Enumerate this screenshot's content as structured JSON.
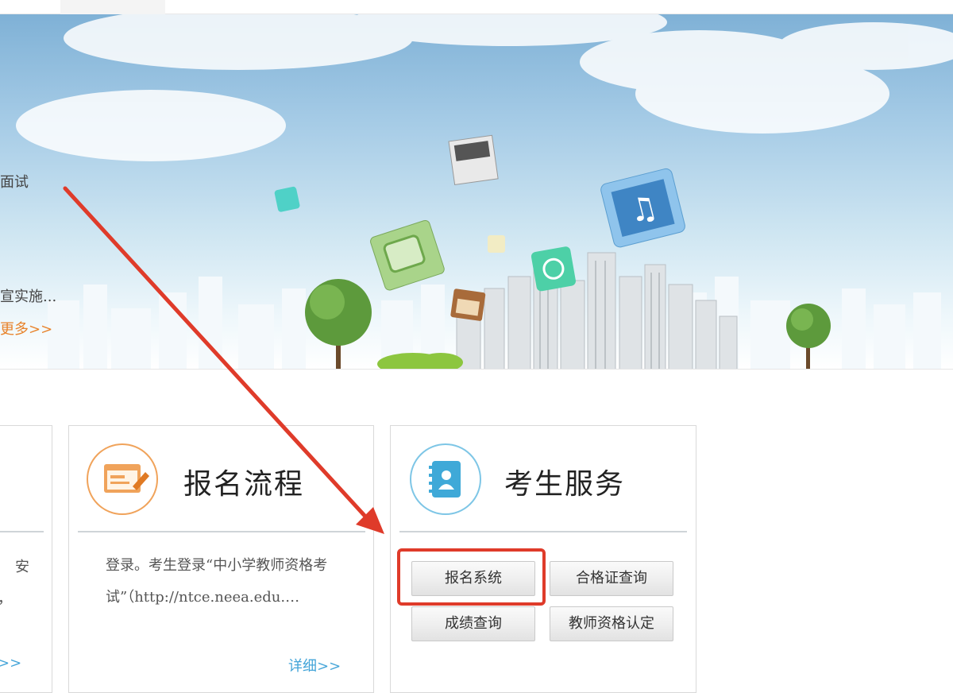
{
  "news": {
    "line1": "面试",
    "line2": "宣实施...",
    "more": "更多>>"
  },
  "left_card": {
    "frag1": "安",
    "frag2": "，",
    "more": ">>"
  },
  "process_card": {
    "title": "报名流程",
    "body": "登录。考生登录“中小学教师资格考试”（http://ntce.neea.edu.…",
    "detail": "详细>>"
  },
  "service_card": {
    "title": "考生服务",
    "buttons": [
      "报名系统",
      "合格证查询",
      "成绩查询",
      "教师资格认定"
    ]
  },
  "colors": {
    "orange": "#e8822a",
    "blue_link": "#43a4d8",
    "annotation_red": "#df3b2a"
  }
}
